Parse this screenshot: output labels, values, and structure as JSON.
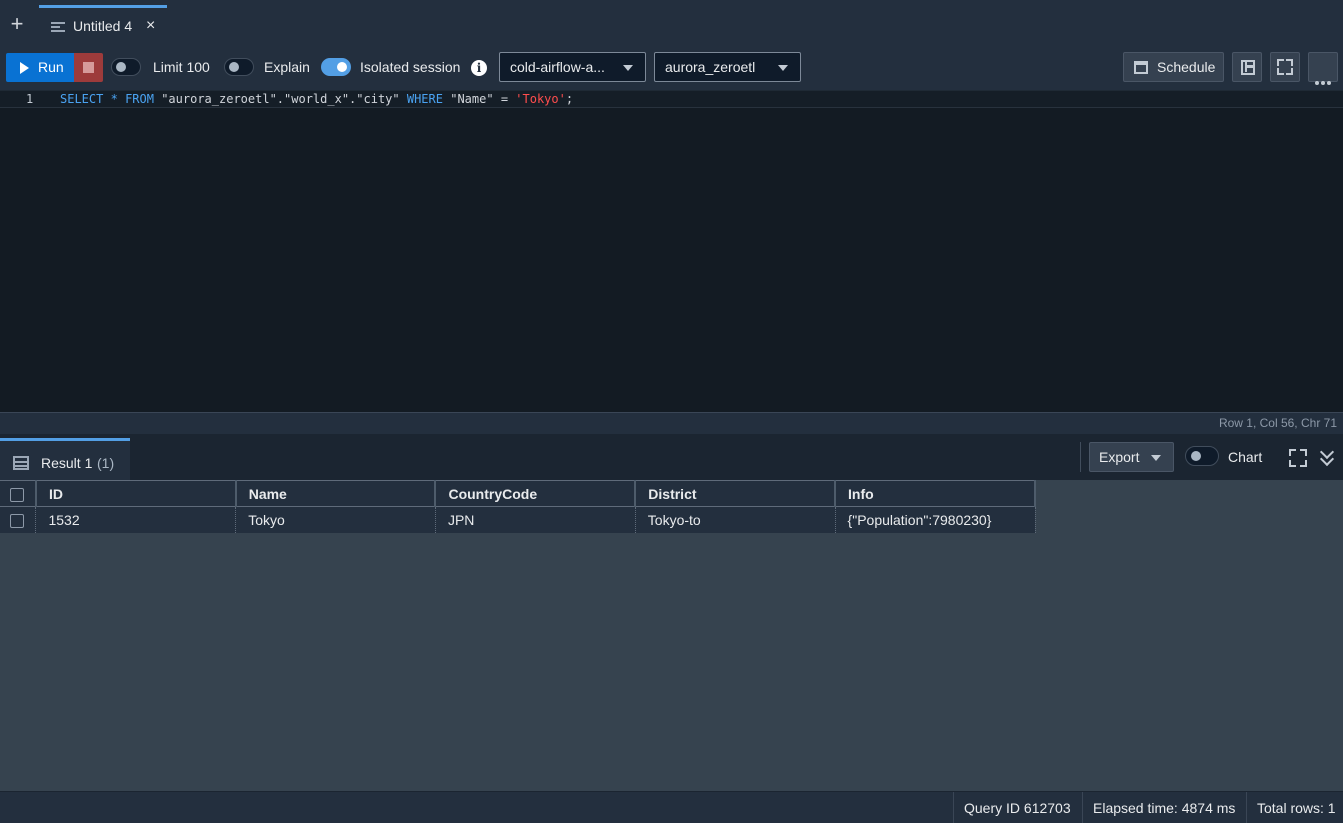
{
  "tabbar": {
    "new_tab_glyph": "+",
    "tab": {
      "label": "Untitled 4",
      "close_glyph": "×"
    }
  },
  "toolbar": {
    "run_label": "Run",
    "limit_label": "Limit 100",
    "limit_enabled": false,
    "explain_label": "Explain",
    "explain_enabled": false,
    "isolated_label": "Isolated session",
    "isolated_enabled": true,
    "info_glyph": "i",
    "connection_select": "cold-airflow-a...",
    "database_select": "aurora_zeroetl",
    "schedule_label": "Schedule"
  },
  "editor": {
    "line_number": "1",
    "tokens": {
      "select": "SELECT",
      "star": "*",
      "from": "FROM",
      "table_ref": "\"aurora_zeroetl\".\"world_x\".\"city\"",
      "where": "WHERE",
      "column": "\"Name\"",
      "eq": "=",
      "value": "'Tokyo'",
      "semicolon": ";"
    },
    "cursor_position": "Row 1,  Col 56,  Chr 71"
  },
  "result": {
    "tab_label": "Result 1",
    "tab_count": "(1)",
    "export_label": "Export",
    "chart_label": "Chart",
    "chart_enabled": false,
    "columns": [
      "ID",
      "Name",
      "CountryCode",
      "District",
      "Info"
    ],
    "rows": [
      [
        "1532",
        "Tokyo",
        "JPN",
        "Tokyo-to",
        "{\"Population\":7980230}"
      ]
    ]
  },
  "footer": {
    "query_id": "Query ID 612703",
    "elapsed": "Elapsed time: 4874 ms",
    "total_rows": "Total rows: 1"
  },
  "colors": {
    "accent": "#0972d3",
    "toggle_on": "#539fe5",
    "stop": "#9d3b3b",
    "keyword": "#4aa3f2",
    "string": "#ff4d4d",
    "background": "#232f3e"
  }
}
